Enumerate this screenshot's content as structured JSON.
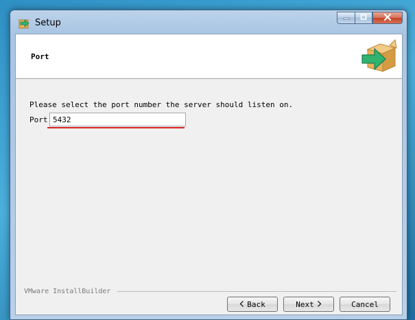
{
  "window": {
    "title": "Setup",
    "icon": "setup-package-icon",
    "controls": [
      "minimize-icon",
      "maximize-icon",
      "close-icon"
    ]
  },
  "header": {
    "title": "Port",
    "logo": "installer-box-logo"
  },
  "body": {
    "prompt": "Please select the port number the server should listen on.",
    "port_label": "Port",
    "port_value": "5432"
  },
  "footer": {
    "brand": "VMware InstallBuilder",
    "back_label": "Back",
    "next_label": "Next",
    "cancel_label": "Cancel"
  },
  "colors": {
    "annotation_underline": "#d62020",
    "logo_arrow": "#2fb36f",
    "logo_box": "#e8b25c"
  }
}
